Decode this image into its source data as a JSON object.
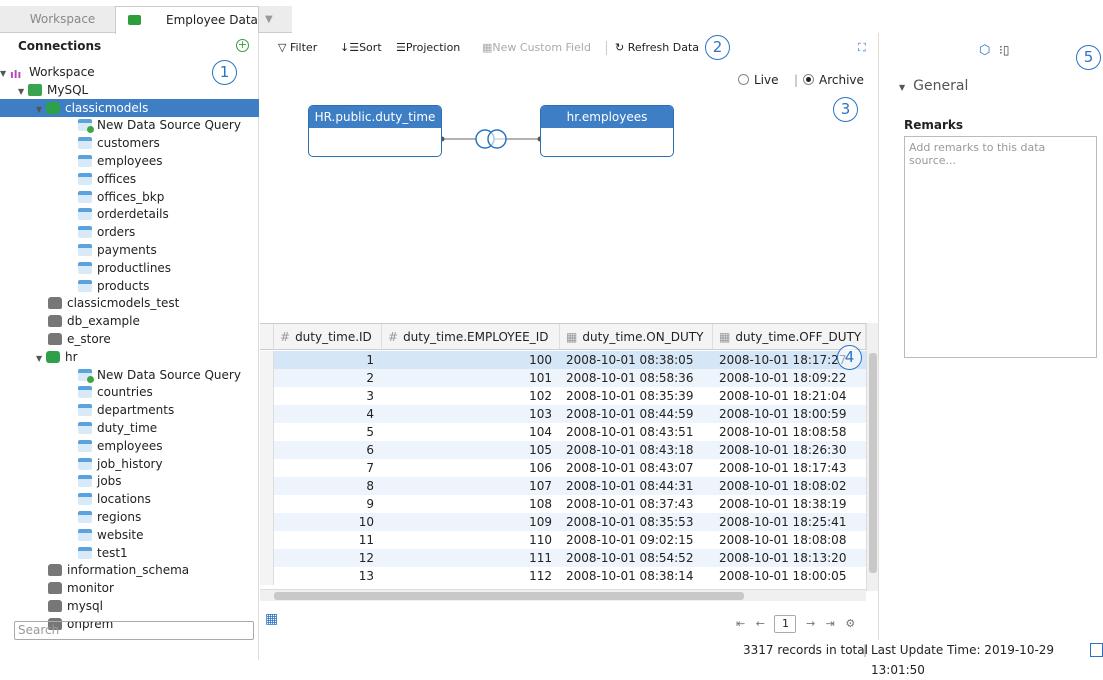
{
  "tabs": {
    "workspace": "Workspace",
    "employee": "Employee Data",
    "dropdown": "▼"
  },
  "left": {
    "title": "Connections",
    "add_icon": "+",
    "search_placeholder": "Search",
    "tree": [
      {
        "label": "Workspace",
        "level": 0,
        "caret": "▼",
        "icon": "workspace"
      },
      {
        "label": "MySQL",
        "level": 1,
        "caret": "▼",
        "icon": "mysql"
      },
      {
        "label": "classicmodels",
        "level": 2,
        "caret": "▼",
        "icon": "dbg",
        "selected": true
      },
      {
        "label": "New Data Source Query",
        "level": 3,
        "icon": "q"
      },
      {
        "label": "customers",
        "level": 3,
        "icon": "tbl"
      },
      {
        "label": "employees",
        "level": 3,
        "icon": "tbl"
      },
      {
        "label": "offices",
        "level": 3,
        "icon": "tbl"
      },
      {
        "label": "offices_bkp",
        "level": 3,
        "icon": "tbl"
      },
      {
        "label": "orderdetails",
        "level": 3,
        "icon": "tbl"
      },
      {
        "label": "orders",
        "level": 3,
        "icon": "tbl"
      },
      {
        "label": "payments",
        "level": 3,
        "icon": "tbl"
      },
      {
        "label": "productlines",
        "level": 3,
        "icon": "tbl"
      },
      {
        "label": "products",
        "level": 3,
        "icon": "tbl"
      },
      {
        "label": "classicmodels_test",
        "level": 2,
        "icon": "db"
      },
      {
        "label": "db_example",
        "level": 2,
        "icon": "db"
      },
      {
        "label": "e_store",
        "level": 2,
        "icon": "db"
      },
      {
        "label": "hr",
        "level": 2,
        "caret": "▼",
        "icon": "dbg"
      },
      {
        "label": "New Data Source Query",
        "level": 3,
        "icon": "q"
      },
      {
        "label": "countries",
        "level": 3,
        "icon": "tbl"
      },
      {
        "label": "departments",
        "level": 3,
        "icon": "tbl"
      },
      {
        "label": "duty_time",
        "level": 3,
        "icon": "tbl"
      },
      {
        "label": "employees",
        "level": 3,
        "icon": "tbl"
      },
      {
        "label": "job_history",
        "level": 3,
        "icon": "tbl"
      },
      {
        "label": "jobs",
        "level": 3,
        "icon": "tbl"
      },
      {
        "label": "locations",
        "level": 3,
        "icon": "tbl"
      },
      {
        "label": "regions",
        "level": 3,
        "icon": "tbl"
      },
      {
        "label": "website",
        "level": 3,
        "icon": "tbl"
      },
      {
        "label": "test1",
        "level": 3,
        "icon": "tbl"
      },
      {
        "label": "information_schema",
        "level": 2,
        "icon": "db"
      },
      {
        "label": "monitor",
        "level": 2,
        "icon": "db"
      },
      {
        "label": "mysql",
        "level": 2,
        "icon": "db"
      },
      {
        "label": "onprem",
        "level": 2,
        "icon": "db"
      }
    ]
  },
  "toolbar": {
    "filter": "Filter",
    "sort": "Sort",
    "projection": "Projection",
    "new_field": "New Custom Field",
    "refresh": "Refresh Data",
    "filter_icon": "▽",
    "sort_icon": "↓☰",
    "projection_icon": "☰",
    "new_field_icon": "▦",
    "refresh_icon": "↻",
    "expand_icon": "⛶"
  },
  "mode": {
    "live": "Live",
    "archive": "Archive",
    "selected": "Archive"
  },
  "diagram": {
    "left": "HR.public.duty_time",
    "right": "hr.employees"
  },
  "grid": {
    "columns": [
      "duty_time.ID",
      "duty_time.EMPLOYEE_ID",
      "duty_time.ON_DUTY",
      "duty_time.OFF_DUTY"
    ],
    "rows": [
      [
        "1",
        "100",
        "2008-10-01 08:38:05",
        "2008-10-01 18:17:27"
      ],
      [
        "2",
        "101",
        "2008-10-01 08:58:36",
        "2008-10-01 18:09:22"
      ],
      [
        "3",
        "102",
        "2008-10-01 08:35:39",
        "2008-10-01 18:21:04"
      ],
      [
        "4",
        "103",
        "2008-10-01 08:44:59",
        "2008-10-01 18:00:59"
      ],
      [
        "5",
        "104",
        "2008-10-01 08:43:51",
        "2008-10-01 18:08:58"
      ],
      [
        "6",
        "105",
        "2008-10-01 08:43:18",
        "2008-10-01 18:26:30"
      ],
      [
        "7",
        "106",
        "2008-10-01 08:43:07",
        "2008-10-01 18:17:43"
      ],
      [
        "8",
        "107",
        "2008-10-01 08:44:31",
        "2008-10-01 18:08:02"
      ],
      [
        "9",
        "108",
        "2008-10-01 08:37:43",
        "2008-10-01 18:38:19"
      ],
      [
        "10",
        "109",
        "2008-10-01 08:35:53",
        "2008-10-01 18:25:41"
      ],
      [
        "11",
        "110",
        "2008-10-01 09:02:15",
        "2008-10-01 18:08:08"
      ],
      [
        "12",
        "111",
        "2008-10-01 08:54:52",
        "2008-10-01 18:13:20"
      ],
      [
        "13",
        "112",
        "2008-10-01 08:38:14",
        "2008-10-01 18:00:05"
      ]
    ]
  },
  "pager": {
    "page": "1",
    "first": "⇤",
    "prev": "←",
    "next": "→",
    "last": "⇥",
    "settings": "⚙"
  },
  "right": {
    "general": "General",
    "remarks_label": "Remarks",
    "remarks_placeholder": "Add remarks to this data source..."
  },
  "status": {
    "records": "3317 records in total",
    "update": "Last Update Time: 2019-10-29 13:01:50"
  },
  "bubbles": [
    "1",
    "2",
    "3",
    "4",
    "5"
  ],
  "accent": "#3d7ec5"
}
